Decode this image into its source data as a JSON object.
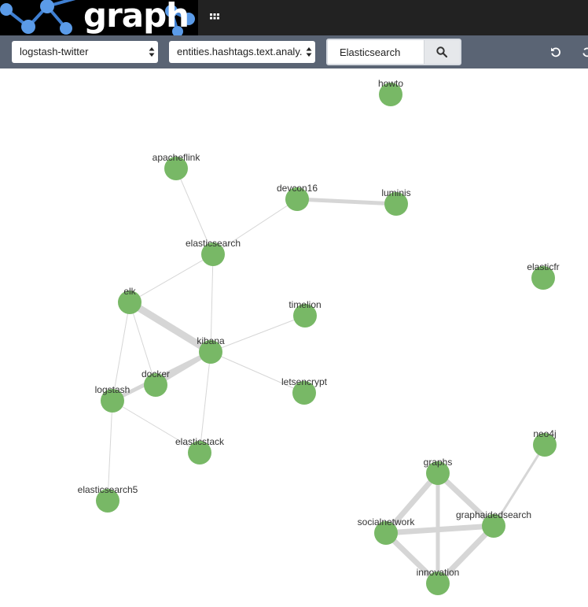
{
  "app": {
    "logo_text": "graph"
  },
  "toolbar": {
    "index_select_value": "logstash-twitter",
    "field_select_value": "entities.hashtags.text.analy.",
    "search_value": "Elasticsearch"
  },
  "colors": {
    "topbar": "#222222",
    "toolbar": "#5a6474",
    "node": "#78b866",
    "edge": "#d6d6d6"
  },
  "graph": {
    "nodes": [
      {
        "id": "howto",
        "label": "howto"
      },
      {
        "id": "apacheflink",
        "label": "apacheflink"
      },
      {
        "id": "devcon16",
        "label": "devcon16"
      },
      {
        "id": "luminis",
        "label": "luminis"
      },
      {
        "id": "elasticsearch",
        "label": "elasticsearch"
      },
      {
        "id": "elasticfr",
        "label": "elasticfr"
      },
      {
        "id": "elk",
        "label": "elk"
      },
      {
        "id": "timelion",
        "label": "timelion"
      },
      {
        "id": "kibana",
        "label": "kibana"
      },
      {
        "id": "docker",
        "label": "docker"
      },
      {
        "id": "letsencrypt",
        "label": "letsencrypt"
      },
      {
        "id": "logstash",
        "label": "logstash"
      },
      {
        "id": "elasticstack",
        "label": "elasticstack"
      },
      {
        "id": "elasticsearch5",
        "label": "elasticsearch5"
      },
      {
        "id": "neo4j",
        "label": "neo4j"
      },
      {
        "id": "graphs",
        "label": "graphs"
      },
      {
        "id": "socialnetwork",
        "label": "socialnetwork"
      },
      {
        "id": "graphaidedsearch",
        "label": "graphaidedsearch"
      },
      {
        "id": "innovation",
        "label": "innovation"
      }
    ],
    "edges": [
      {
        "source": "apacheflink",
        "target": "elasticsearch",
        "weight": 1
      },
      {
        "source": "devcon16",
        "target": "elasticsearch",
        "weight": 1
      },
      {
        "source": "devcon16",
        "target": "luminis",
        "weight": 3
      },
      {
        "source": "elasticsearch",
        "target": "elk",
        "weight": 1
      },
      {
        "source": "elasticsearch",
        "target": "kibana",
        "weight": 1
      },
      {
        "source": "elk",
        "target": "kibana",
        "weight": 5
      },
      {
        "source": "elk",
        "target": "docker",
        "weight": 1
      },
      {
        "source": "elk",
        "target": "logstash",
        "weight": 1
      },
      {
        "source": "kibana",
        "target": "timelion",
        "weight": 1
      },
      {
        "source": "kibana",
        "target": "letsencrypt",
        "weight": 1
      },
      {
        "source": "kibana",
        "target": "docker",
        "weight": 3
      },
      {
        "source": "kibana",
        "target": "logstash",
        "weight": 3
      },
      {
        "source": "kibana",
        "target": "elasticstack",
        "weight": 1
      },
      {
        "source": "logstash",
        "target": "elasticstack",
        "weight": 1
      },
      {
        "source": "logstash",
        "target": "elasticsearch5",
        "weight": 1
      },
      {
        "source": "graphs",
        "target": "socialnetwork",
        "weight": 4
      },
      {
        "source": "graphs",
        "target": "graphaidedsearch",
        "weight": 4
      },
      {
        "source": "graphs",
        "target": "innovation",
        "weight": 3
      },
      {
        "source": "socialnetwork",
        "target": "graphaidedsearch",
        "weight": 4
      },
      {
        "source": "socialnetwork",
        "target": "innovation",
        "weight": 4
      },
      {
        "source": "graphaidedsearch",
        "target": "innovation",
        "weight": 4
      },
      {
        "source": "graphaidedsearch",
        "target": "neo4j",
        "weight": 2
      }
    ]
  }
}
